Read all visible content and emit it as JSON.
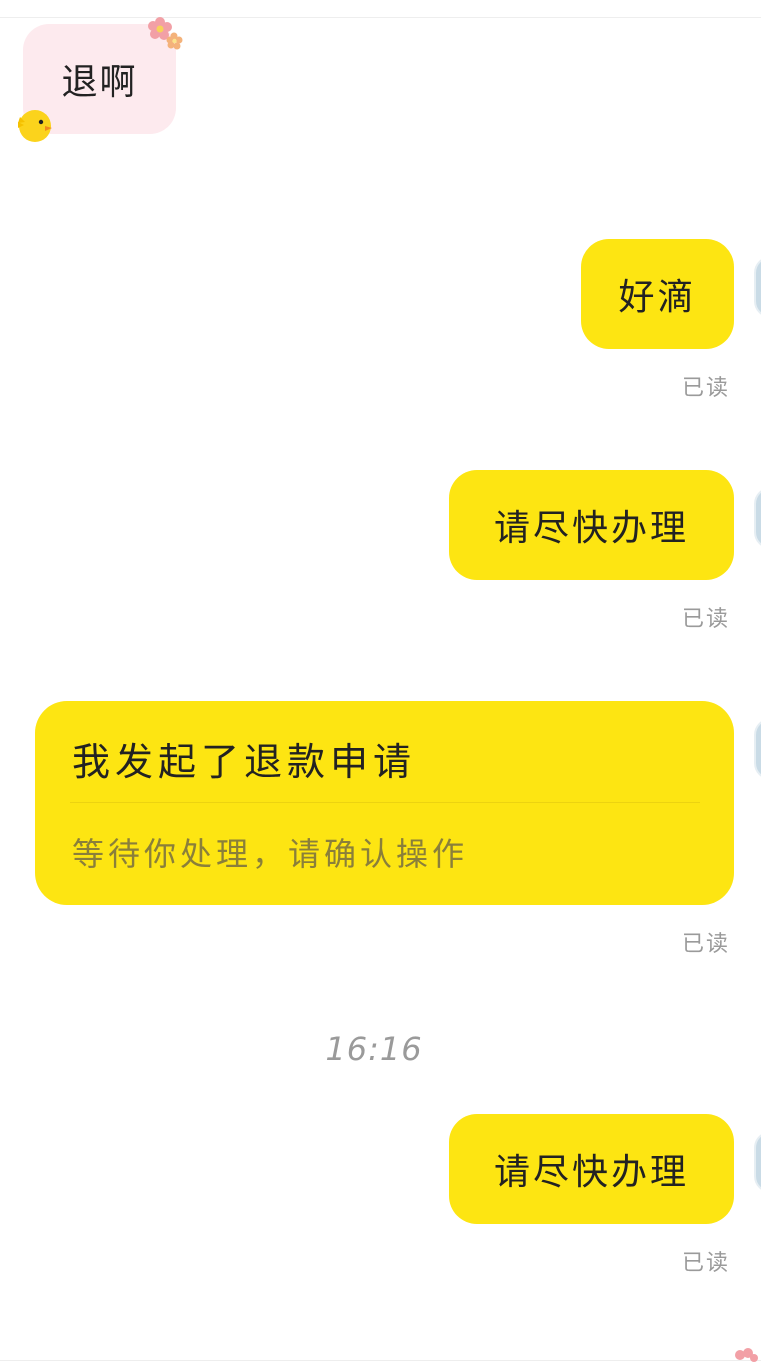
{
  "messages": [
    {
      "side": "incoming",
      "text": "退啊"
    },
    {
      "side": "outgoing",
      "text": "好滴",
      "status": "已读"
    },
    {
      "side": "outgoing",
      "text": "请尽快办理",
      "status": "已读"
    },
    {
      "side": "outgoing",
      "type": "refund-card",
      "title": "我发起了退款申请",
      "subtitle": "等待你处理，请确认操作",
      "status": "已读"
    },
    {
      "side": "outgoing",
      "text": "请尽快办理",
      "status": "已读"
    }
  ],
  "timestamp": "16:16",
  "colors": {
    "outgoing_bubble": "#fde512",
    "incoming_bubble": "#fdeaee",
    "read_label": "#9a9a9a"
  },
  "icons": {
    "decor_top": "flower-icon",
    "decor_bottom": "chick-icon"
  }
}
